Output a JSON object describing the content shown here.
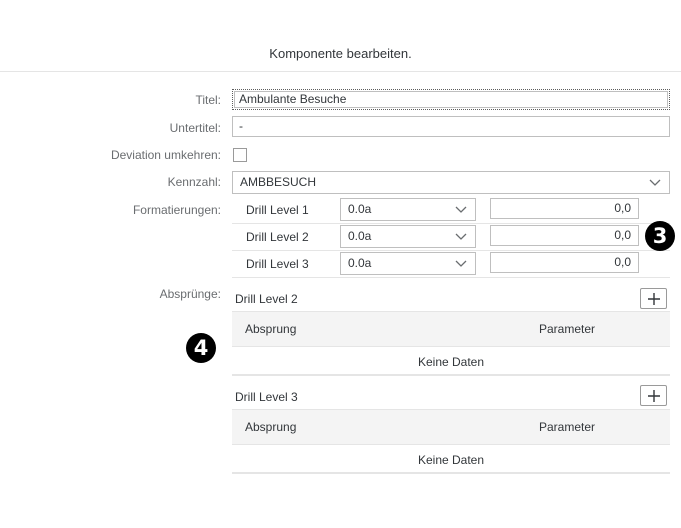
{
  "dialog": {
    "title": "Komponente bearbeiten."
  },
  "form": {
    "titel": {
      "label": "Titel:",
      "value": "Ambulante Besuche"
    },
    "untertitel": {
      "label": "Untertitel:",
      "value": "-"
    },
    "deviation": {
      "label": "Deviation umkehren:",
      "checked": false
    },
    "kennzahl": {
      "label": "Kennzahl:",
      "value": "AMBBESUCH"
    },
    "formatierungen": {
      "label": "Formatierungen:",
      "rows": [
        {
          "level": "Drill Level 1",
          "format": "0.0a",
          "value": "0,0"
        },
        {
          "level": "Drill Level 2",
          "format": "0.0a",
          "value": "0,0"
        },
        {
          "level": "Drill Level 3",
          "format": "0.0a",
          "value": "0,0"
        }
      ]
    },
    "absprunge": {
      "label": "Absprünge:",
      "sections": [
        {
          "title": "Drill Level 2",
          "col_absprung": "Absprung",
          "col_parameter": "Parameter",
          "empty_text": "Keine Daten"
        },
        {
          "title": "Drill Level 3",
          "col_absprung": "Absprung",
          "col_parameter": "Parameter",
          "empty_text": "Keine Daten"
        }
      ]
    }
  },
  "annotations": {
    "badge_3": "3",
    "badge_4": "4"
  },
  "icons": {
    "dropdown": "chevron-down-icon",
    "add": "plus-icon"
  }
}
